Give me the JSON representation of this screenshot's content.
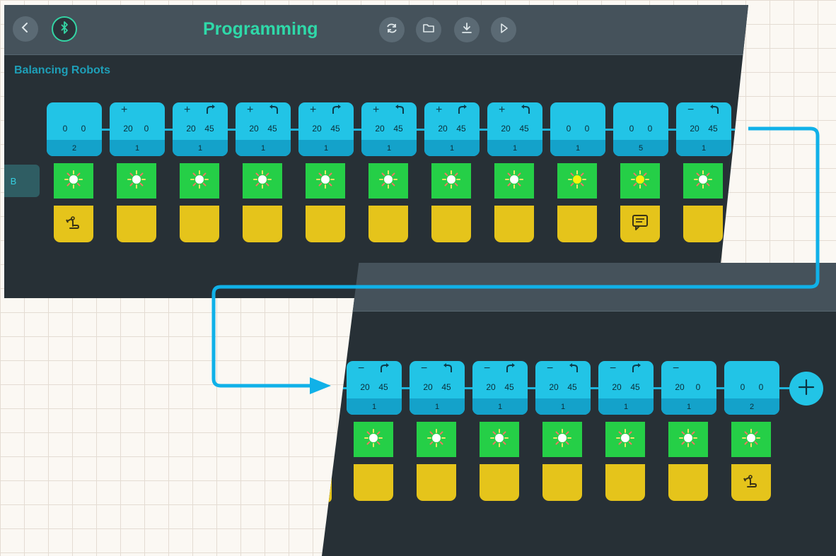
{
  "header": {
    "title": "Programming",
    "subtitle": "Balancing Robots",
    "side_tab": "B",
    "back_icon": "chevron-left-icon",
    "bluetooth_icon": "bluetooth-icon",
    "tools": [
      "refresh-icon",
      "folder-icon",
      "download-icon",
      "play-icon"
    ]
  },
  "colors": {
    "panel_bg": "#273036",
    "toolbar_bg": "#45525b",
    "accent_green": "#2fd9a9",
    "card_blue": "#22c4e6",
    "card_dark": "#14a2ca",
    "light_green": "#25cf47",
    "action_yellow": "#e5c41b",
    "connector_blue": "#1fb5dc"
  },
  "steps_top": [
    {
      "sign": "",
      "turn": "",
      "v1": "0",
      "v2": "0",
      "dur": "2",
      "light": "white",
      "action": "robot-arm-icon"
    },
    {
      "sign": "+",
      "turn": "",
      "v1": "20",
      "v2": "0",
      "dur": "1",
      "light": "white",
      "action": ""
    },
    {
      "sign": "+",
      "turn": "turn-right-icon",
      "v1": "20",
      "v2": "45",
      "dur": "1",
      "light": "white",
      "action": ""
    },
    {
      "sign": "+",
      "turn": "turn-left-icon",
      "v1": "20",
      "v2": "45",
      "dur": "1",
      "light": "white",
      "action": ""
    },
    {
      "sign": "+",
      "turn": "turn-right-icon",
      "v1": "20",
      "v2": "45",
      "dur": "1",
      "light": "white",
      "action": ""
    },
    {
      "sign": "+",
      "turn": "turn-left-icon",
      "v1": "20",
      "v2": "45",
      "dur": "1",
      "light": "white",
      "action": ""
    },
    {
      "sign": "+",
      "turn": "turn-right-icon",
      "v1": "20",
      "v2": "45",
      "dur": "1",
      "light": "white",
      "action": ""
    },
    {
      "sign": "+",
      "turn": "turn-left-icon",
      "v1": "20",
      "v2": "45",
      "dur": "1",
      "light": "white",
      "action": ""
    },
    {
      "sign": "",
      "turn": "",
      "v1": "0",
      "v2": "0",
      "dur": "1",
      "light": "yellow",
      "action": ""
    },
    {
      "sign": "",
      "turn": "",
      "v1": "0",
      "v2": "0",
      "dur": "5",
      "light": "yellow",
      "action": "message-icon"
    },
    {
      "sign": "−",
      "turn": "turn-left-icon",
      "v1": "20",
      "v2": "45",
      "dur": "1",
      "light": "white",
      "action": ""
    }
  ],
  "steps_bottom": [
    {
      "sign": "−",
      "turn": "turn-right-icon",
      "v1": "20",
      "v2": "45",
      "dur": "1",
      "light": "white",
      "action": ""
    },
    {
      "sign": "−",
      "turn": "turn-left-icon",
      "v1": "20",
      "v2": "45",
      "dur": "1",
      "light": "white",
      "action": ""
    },
    {
      "sign": "−",
      "turn": "turn-right-icon",
      "v1": "20",
      "v2": "45",
      "dur": "1",
      "light": "white",
      "action": ""
    },
    {
      "sign": "−",
      "turn": "turn-left-icon",
      "v1": "20",
      "v2": "45",
      "dur": "1",
      "light": "white",
      "action": ""
    },
    {
      "sign": "−",
      "turn": "turn-right-icon",
      "v1": "20",
      "v2": "45",
      "dur": "1",
      "light": "white",
      "action": ""
    },
    {
      "sign": "−",
      "turn": "",
      "v1": "20",
      "v2": "0",
      "dur": "1",
      "light": "white",
      "action": ""
    },
    {
      "sign": "",
      "turn": "",
      "v1": "0",
      "v2": "0",
      "dur": "2",
      "light": "white",
      "action": "robot-arm-icon"
    }
  ],
  "add_button_icon": "plus-icon"
}
